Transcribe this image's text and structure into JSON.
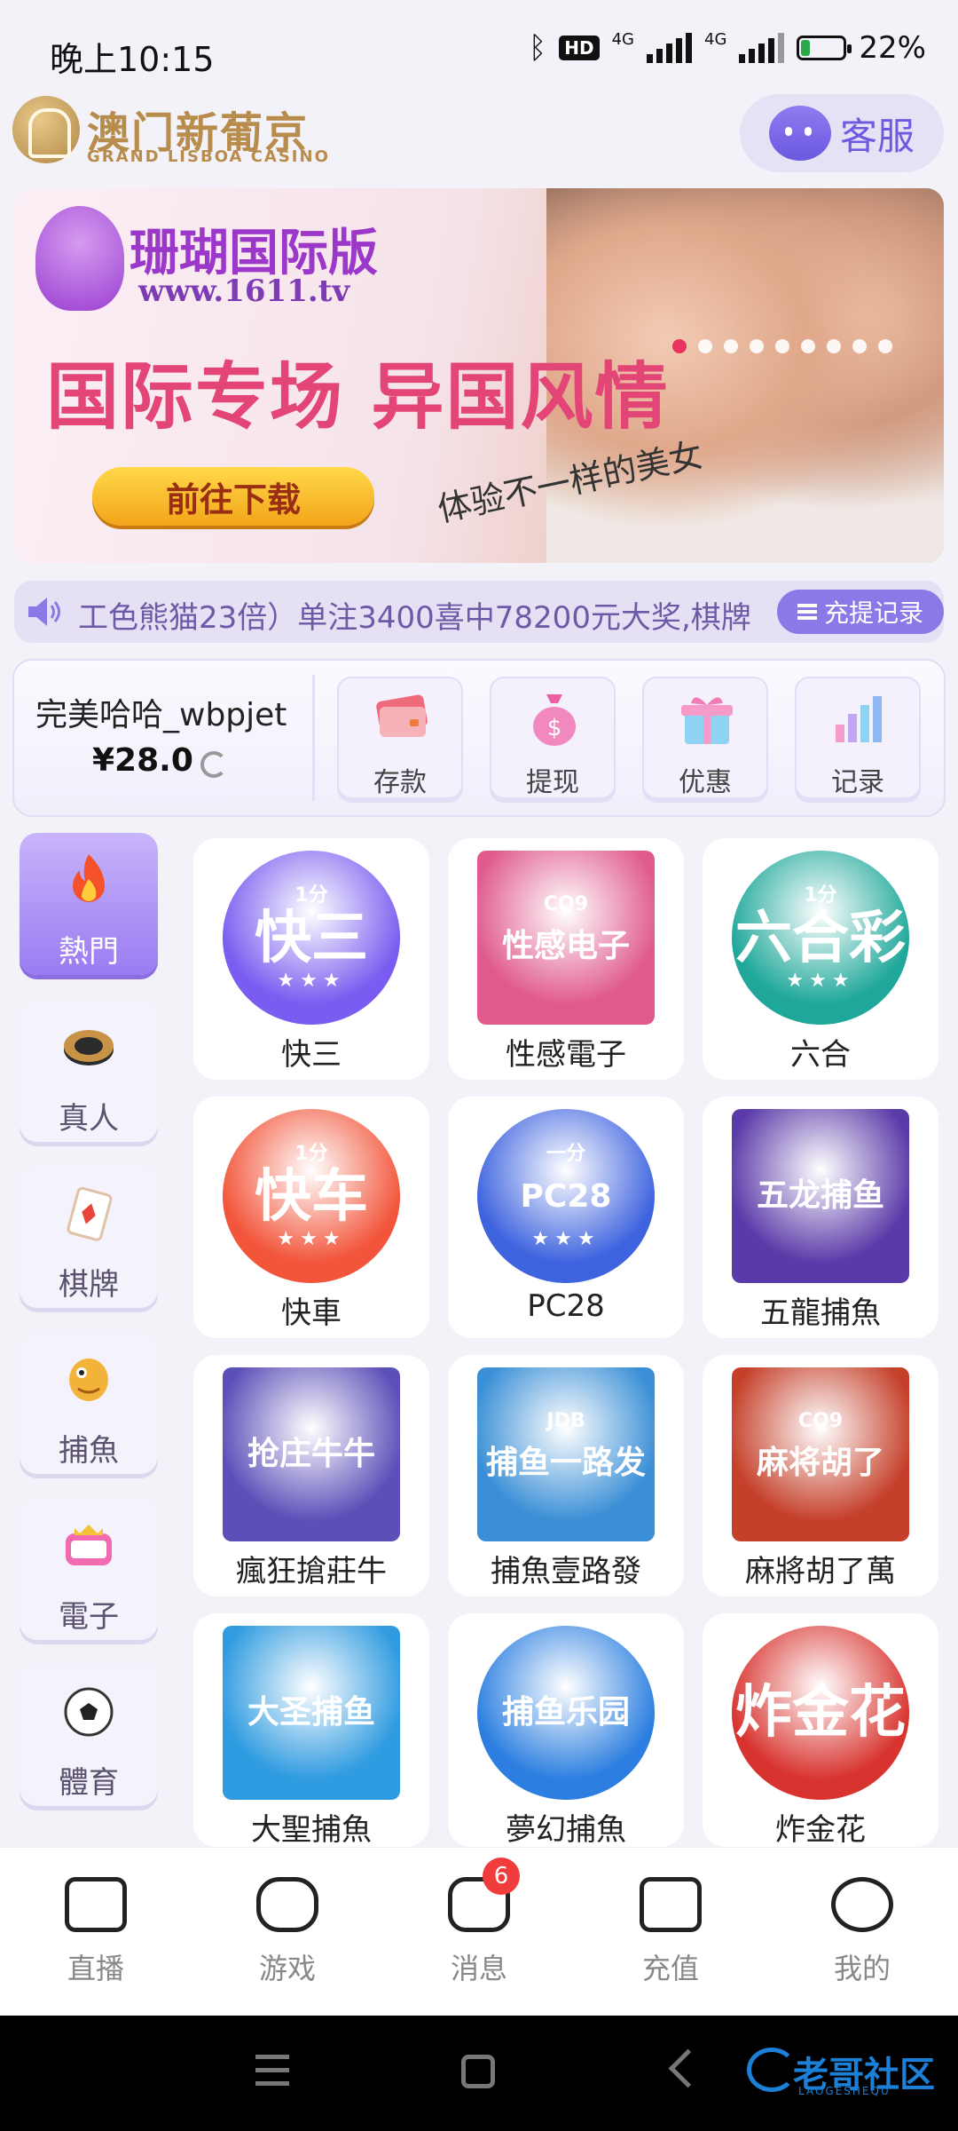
{
  "status_bar": {
    "time": "晚上10:15",
    "hd": "HD",
    "net1": "4G",
    "net2": "4G",
    "battery": "22%",
    "battery_level": 0.22
  },
  "header": {
    "brand_cn": "澳门新葡京",
    "brand_en": "GRAND LISBOA CASINO",
    "service_label": "客服"
  },
  "banner": {
    "brand": "珊瑚国际版",
    "url": "www.1611.tv",
    "headline": "国际专场 异国风情",
    "button": "前往下载",
    "tagline": "体验不一样的美女",
    "slide_count": 9,
    "active_slide": 0
  },
  "marquee": {
    "text": "工色熊猫23倍）单注3400喜中78200元大奖,棋牌",
    "record_button": "充提记录"
  },
  "wallet": {
    "username": "完美哈哈_wbpjet",
    "balance": "¥28.0",
    "actions": [
      {
        "label": "存款",
        "icon": "card-icon"
      },
      {
        "label": "提现",
        "icon": "money-bag-icon"
      },
      {
        "label": "优惠",
        "icon": "gift-icon"
      },
      {
        "label": "记录",
        "icon": "bar-chart-icon"
      }
    ]
  },
  "categories": [
    {
      "label": "熱門",
      "icon": "flame-icon",
      "active": true
    },
    {
      "label": "真人",
      "icon": "chip-icon",
      "active": false
    },
    {
      "label": "棋牌",
      "icon": "playing-card-icon",
      "active": false
    },
    {
      "label": "捕魚",
      "icon": "fish-icon",
      "active": false
    },
    {
      "label": "電子",
      "icon": "slot-machine-icon",
      "active": false
    },
    {
      "label": "體育",
      "icon": "soccer-ball-icon",
      "active": false
    }
  ],
  "games": [
    {
      "name": "快三",
      "tile_small": "1分",
      "tile_big": "快三",
      "color": "#7a5cf0"
    },
    {
      "name": "性感電子",
      "tile_small": "CQ9",
      "tile_big": "性感电子",
      "color": "#e05a8e"
    },
    {
      "name": "六合",
      "tile_small": "1分",
      "tile_big": "六合彩",
      "color": "#1fa89a"
    },
    {
      "name": "快車",
      "tile_small": "1分",
      "tile_big": "快车",
      "color": "#f2553a"
    },
    {
      "name": "PC28",
      "tile_small": "一分",
      "tile_big": "PC28",
      "color": "#3e63df"
    },
    {
      "name": "五龍捕魚",
      "tile_small": "",
      "tile_big": "五龙捕鱼",
      "color": "#5a3aa8"
    },
    {
      "name": "瘋狂搶莊牛",
      "tile_small": "",
      "tile_big": "抢庄牛牛",
      "color": "#5b4fb8"
    },
    {
      "name": "捕魚壹路發",
      "tile_small": "JDB",
      "tile_big": "捕鱼一路发",
      "color": "#3a8fd6"
    },
    {
      "name": "麻將胡了萬",
      "tile_small": "CQ9",
      "tile_big": "麻将胡了",
      "color": "#c5402a"
    },
    {
      "name": "大聖捕魚",
      "tile_small": "",
      "tile_big": "大圣捕鱼",
      "color": "#2f9be0"
    },
    {
      "name": "夢幻捕魚",
      "tile_small": "",
      "tile_big": "捕鱼乐园",
      "color": "#2c7fe0"
    },
    {
      "name": "炸金花",
      "tile_small": "",
      "tile_big": "炸金花",
      "color": "#d8332e"
    }
  ],
  "bottom_nav": [
    {
      "label": "直播",
      "icon": "camera-icon"
    },
    {
      "label": "游戏",
      "icon": "gamepad-icon"
    },
    {
      "label": "消息",
      "icon": "chat-icon",
      "badge": "6"
    },
    {
      "label": "充值",
      "icon": "wallet-icon"
    },
    {
      "label": "我的",
      "icon": "smile-icon"
    }
  ],
  "watermark": {
    "text": "老哥社区",
    "sub": "LAOGESHEQU"
  },
  "colors": {
    "accent": "#8c79e8",
    "brand_gold": "#b88c4d",
    "badge": "#f03c3c"
  }
}
